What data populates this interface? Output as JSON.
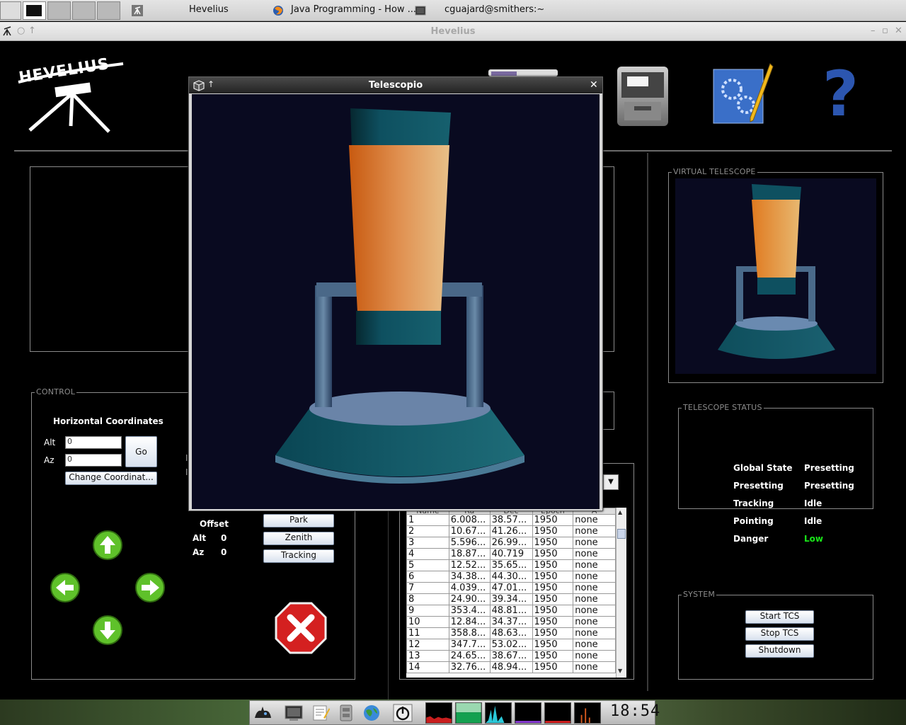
{
  "taskbar": {
    "tasks": [
      {
        "label": "Hevelius",
        "icon": "telescope-icon"
      },
      {
        "label": "Java Programming - How ...",
        "icon": "firefox-icon"
      },
      {
        "label": "cguajard@smithers:~",
        "icon": "terminal-icon"
      }
    ]
  },
  "window": {
    "title": "Hevelius",
    "controls": [
      "minimize-icon",
      "restore-icon",
      "close-icon"
    ]
  },
  "app": {
    "logo_text": "HEVELIUS",
    "toolbar_icons": [
      "file-cabinet-icon",
      "settings-blueprint-icon",
      "help-question-icon"
    ]
  },
  "control": {
    "legend": "CONTROL",
    "heading": "Horizontal Coordinates",
    "alt_label": "Alt",
    "az_label": "Az",
    "alt_value": "0",
    "az_value": "0",
    "go_label": "Go",
    "change_label": "Change Coordinat...",
    "offset_label": "Offset",
    "offset_alt_label": "Alt",
    "offset_alt_value": "0",
    "offset_az_label": "Az",
    "offset_az_value": "0",
    "park_label": "Park",
    "zenith_label": "Zenith",
    "tracking_label": "Tracking",
    "arrow_icons": [
      "arrow-up-icon",
      "arrow-left-icon",
      "arrow-right-icon",
      "arrow-down-icon"
    ],
    "stop_icon": "stop-x-icon"
  },
  "catalog": {
    "columns": [
      "Name",
      "Ra",
      "Dec",
      "Epoch",
      "A"
    ],
    "rows": [
      [
        "1",
        "6.008...",
        "38.57...",
        "1950",
        "none"
      ],
      [
        "2",
        "10.67...",
        "41.26...",
        "1950",
        "none"
      ],
      [
        "3",
        "5.596...",
        "26.99...",
        "1950",
        "none"
      ],
      [
        "4",
        "18.87...",
        "40.719",
        "1950",
        "none"
      ],
      [
        "5",
        "12.52...",
        "35.65...",
        "1950",
        "none"
      ],
      [
        "6",
        "34.38...",
        "44.30...",
        "1950",
        "none"
      ],
      [
        "7",
        "4.039...",
        "47.01...",
        "1950",
        "none"
      ],
      [
        "8",
        "24.90...",
        "39.34...",
        "1950",
        "none"
      ],
      [
        "9",
        "353.4...",
        "48.81...",
        "1950",
        "none"
      ],
      [
        "10",
        "12.84...",
        "34.37...",
        "1950",
        "none"
      ],
      [
        "11",
        "358.8...",
        "48.63...",
        "1950",
        "none"
      ],
      [
        "12",
        "347.7...",
        "53.02...",
        "1950",
        "none"
      ],
      [
        "13",
        "24.65...",
        "38.67...",
        "1950",
        "none"
      ],
      [
        "14",
        "32.76...",
        "48.94...",
        "1950",
        "none"
      ]
    ]
  },
  "virtual_telescope": {
    "legend": "VIRTUAL TELESCOPE"
  },
  "status": {
    "legend": "TELESCOPE STATUS",
    "rows": [
      {
        "key": "Global State",
        "value": "Presetting"
      },
      {
        "key": "Presetting",
        "value": "Presetting"
      },
      {
        "key": "Tracking",
        "value": "Idle"
      },
      {
        "key": "Pointing",
        "value": "Idle"
      },
      {
        "key": "Danger",
        "value": "Low"
      }
    ],
    "danger_color": "#19e619"
  },
  "system": {
    "legend": "SYSTEM",
    "start_label": "Start TCS",
    "stop_label": "Stop TCS",
    "shutdown_label": "Shutdown"
  },
  "popup": {
    "title": "Telescopio",
    "icons": [
      "cube-icon",
      "pin-up-icon",
      "close-icon"
    ]
  },
  "dock": {
    "icons": [
      "cat-launcher-icon",
      "terminal-icon",
      "text-editor-icon",
      "file-manager-icon",
      "globe-icon",
      "power-icon"
    ],
    "monitors": [
      "cpu-monitor",
      "memory-monitor",
      "network-monitor",
      "disk-monitor",
      "swap-monitor",
      "load-monitor"
    ],
    "clock": "18:54"
  },
  "colors": {
    "tube_orange": "#e08a3a",
    "tube_teal": "#0d5a6a",
    "scene_bg": "#090a20"
  }
}
